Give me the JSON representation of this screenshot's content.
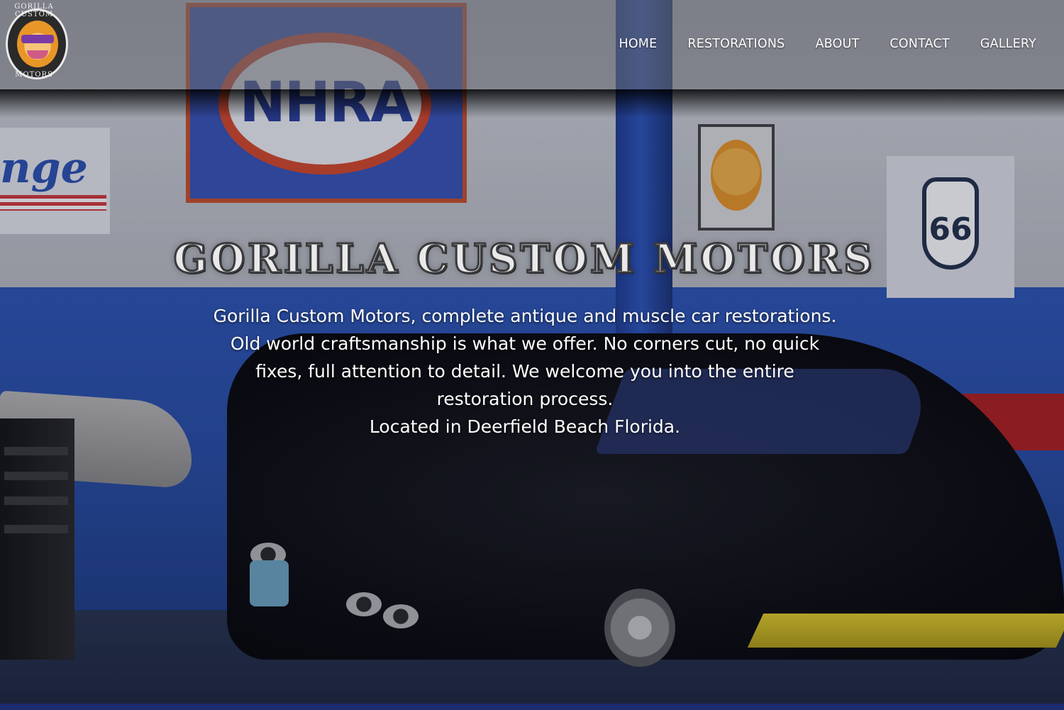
{
  "brand": {
    "logo_text_top": "GORILLA CUSTOM",
    "logo_text_bottom": "MOTORS",
    "colors": {
      "logo_orange": "#e89628",
      "logo_purple": "#7a3aa5"
    }
  },
  "nav": {
    "items": [
      {
        "label": "HOME"
      },
      {
        "label": "RESTORATIONS"
      },
      {
        "label": "ABOUT"
      },
      {
        "label": "CONTACT"
      },
      {
        "label": "GALLERY"
      }
    ]
  },
  "hero": {
    "title": "GORILLA CUSTOM MOTORS",
    "description": "Gorilla Custom Motors, complete antique and muscle car restorations. Old world craftsmanship is what we offer. No corners cut, no quick fixes, full attention to detail. We welcome you into the entire restoration process.",
    "location": "Located in Deerfield Beach Florida."
  },
  "background": {
    "banner_text": "NHRA",
    "sign_text": "nge",
    "route_number": "66"
  }
}
